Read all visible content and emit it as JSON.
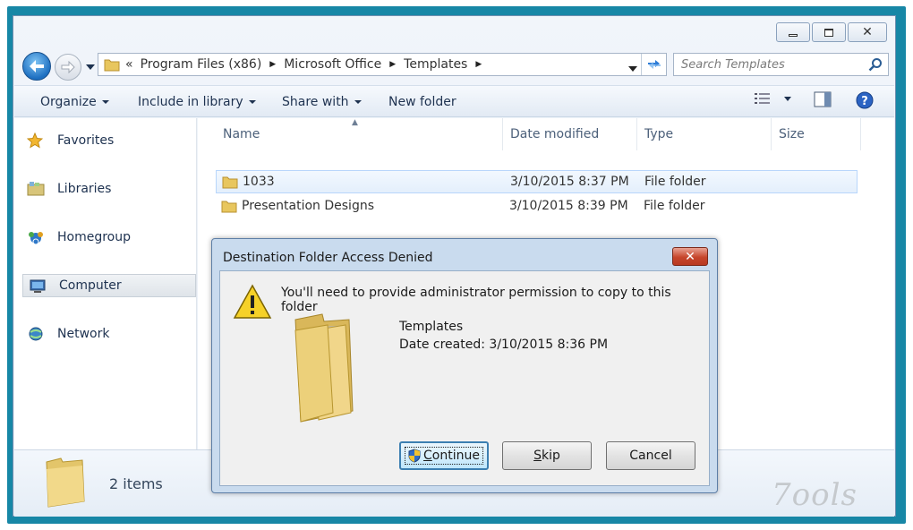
{
  "window": {
    "controls": {
      "minimize": "—",
      "maximize": "□",
      "close": "✕"
    }
  },
  "address": {
    "overflow": "«",
    "crumbs": [
      "Program Files (x86)",
      "Microsoft Office",
      "Templates"
    ],
    "search_placeholder": "Search Templates"
  },
  "toolbar": {
    "organize": "Organize",
    "include_in_library": "Include in library",
    "share_with": "Share with",
    "new_folder": "New folder"
  },
  "nav": {
    "items": [
      {
        "label": "Favorites",
        "icon": "star-icon"
      },
      {
        "label": "Libraries",
        "icon": "libraries-icon"
      },
      {
        "label": "Homegroup",
        "icon": "homegroup-icon"
      },
      {
        "label": "Computer",
        "icon": "computer-icon",
        "selected": true
      },
      {
        "label": "Network",
        "icon": "network-icon"
      }
    ]
  },
  "columns": {
    "name": "Name",
    "date_modified": "Date modified",
    "type": "Type",
    "size": "Size"
  },
  "files": [
    {
      "name": "1033",
      "date": "3/10/2015 8:37 PM",
      "type": "File folder",
      "selected": true
    },
    {
      "name": "Presentation Designs",
      "date": "3/10/2015 8:39 PM",
      "type": "File folder",
      "selected": false
    }
  ],
  "status": {
    "item_count": "2 items"
  },
  "dialog": {
    "title": "Destination Folder Access Denied",
    "close": "✕",
    "message": "You'll need to provide administrator permission to copy to this folder",
    "folder_name": "Templates",
    "date_created": "Date created: 3/10/2015 8:36 PM",
    "buttons": {
      "continue_first": "C",
      "continue_rest": "ontinue",
      "skip_first": "S",
      "skip_rest": "kip",
      "cancel": "Cancel"
    }
  },
  "watermark": "7ools",
  "colors": {
    "frame": "#1787a6",
    "dialog_frame": "#c9dbee",
    "accent": "#1d6fc1"
  }
}
